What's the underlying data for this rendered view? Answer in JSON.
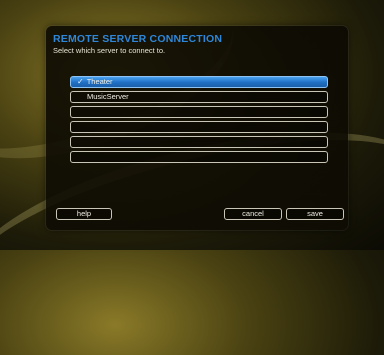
{
  "dialog": {
    "title": "REMOTE SERVER CONNECTION",
    "subtitle": "Select which server to connect to."
  },
  "servers": [
    {
      "label": "Theater",
      "selected": true
    },
    {
      "label": "MusicServer",
      "selected": false
    },
    {
      "label": "",
      "selected": false
    },
    {
      "label": "",
      "selected": false
    },
    {
      "label": "",
      "selected": false
    },
    {
      "label": "",
      "selected": false
    }
  ],
  "buttons": {
    "help": "help",
    "cancel": "cancel",
    "save": "save"
  },
  "icons": {
    "selected_marker": "checkmark-icon"
  },
  "colors": {
    "title": "#2e87d9",
    "selection": "#2a7fd4",
    "background_gold": "#8a7a28"
  }
}
